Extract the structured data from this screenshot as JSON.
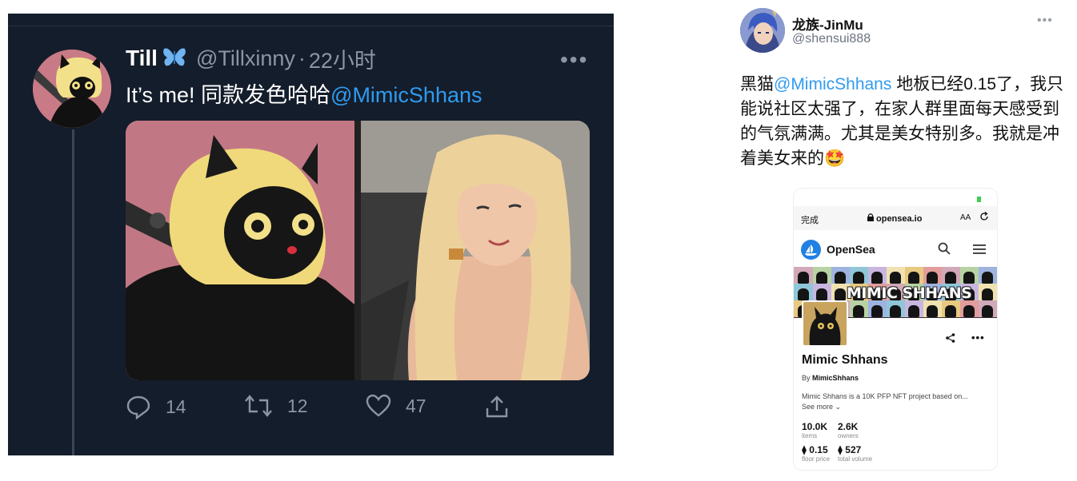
{
  "left_tweet": {
    "name": "Till",
    "handle": "@Tillxinny",
    "separator": "·",
    "time": "22小时",
    "more": "•••",
    "text_prefix": "It’s me! 同款发色哈哈",
    "mention": "@MimicShhans",
    "actions": {
      "reply_count": "14",
      "retweet_count": "12",
      "like_count": "47"
    }
  },
  "right_tweet": {
    "name": "龙族-JinMu",
    "handle": "@shensui888",
    "more": "•••",
    "text_prefix": "黑猫",
    "mention": "@MimicShhans",
    "text_rest": " 地板已经0.15了，我只能说社区太强了，在家人群里面每天感受到的气氛满满。尤其是美女特别多。我就是冲着美女来的🤩"
  },
  "phone": {
    "browser_done": "完成",
    "url": "opensea.io",
    "text_size": "AA",
    "site_name": "OpenSea",
    "banner_title": "MIMIC SHHANS",
    "collection_name": "Mimic Shhans",
    "by_prefix": "By",
    "by_name": "MimicShhans",
    "description": "Mimic Shhans is a 10K PFP NFT project based on...",
    "see_more": "See more ⌄",
    "stats": {
      "items_value": "10.0K",
      "items_label": "items",
      "owners_value": "2.6K",
      "owners_label": "owners",
      "floor_value": "⧫ 0.15",
      "floor_label": "floor price",
      "volume_value": "⧫ 527",
      "volume_label": "total volume"
    }
  },
  "colors": {
    "dark_bg": "#141d2b",
    "mention_blue": "#2f9bf0",
    "opensea_blue": "#2081e2"
  }
}
